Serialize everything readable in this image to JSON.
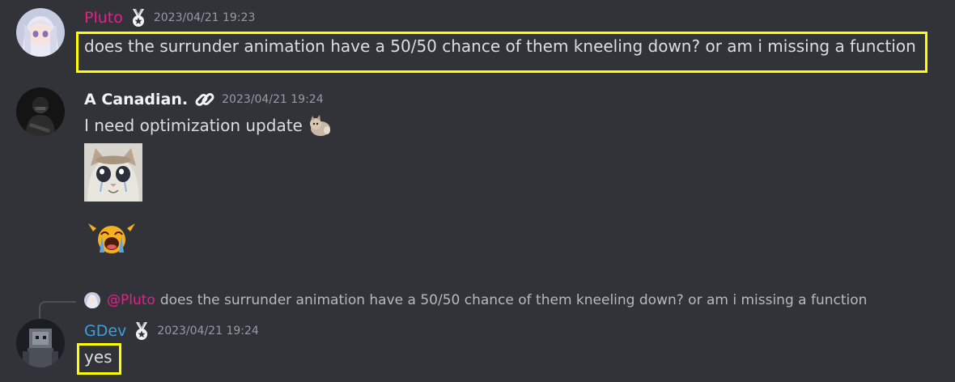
{
  "messages": [
    {
      "username": "Pluto",
      "username_color": "#e91e8c",
      "badge": "medal-icon",
      "timestamp": "2023/04/21 19:23",
      "text": "does the surrunder animation have a 50/50 chance of them kneeling down? or am i missing a function"
    },
    {
      "username": "A Canadian.",
      "username_color": "#f2f3f5",
      "badge": "link-icon",
      "timestamp": "2023/04/21 19:24",
      "text": "I need optimization update",
      "inline_emoji": "cat-emoji",
      "attachments": [
        "crying-cat-sticker",
        "crying-face-emoji"
      ]
    },
    {
      "reply": {
        "mention": "@Pluto",
        "mention_color": "#e91e8c",
        "text": "does the surrunder animation have a 50/50 chance of them kneeling down? or am i missing a function"
      },
      "username": "GDev",
      "username_color": "#3b9fe0",
      "badge": "medal-icon",
      "timestamp": "2023/04/21 19:24",
      "text": "yes"
    }
  ],
  "highlight_color": "#ffff00"
}
